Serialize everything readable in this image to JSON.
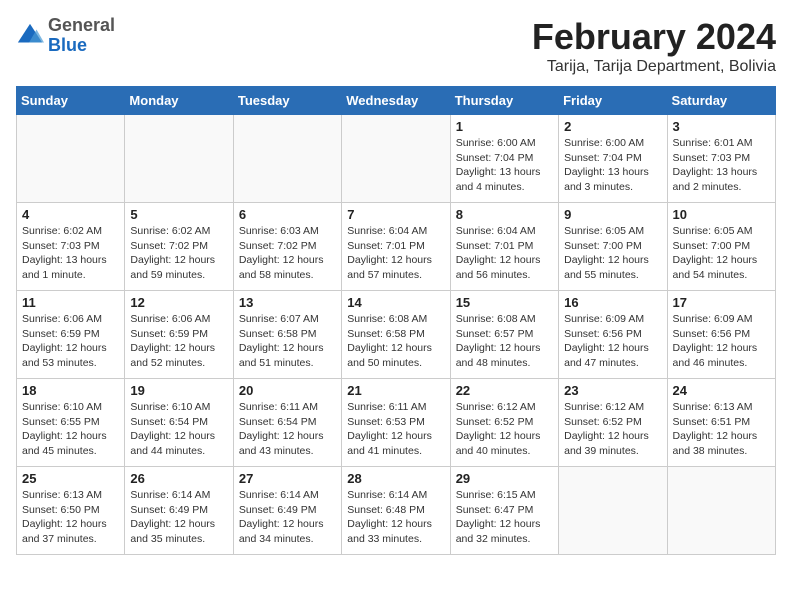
{
  "header": {
    "logo_line1": "General",
    "logo_line2": "Blue",
    "title": "February 2024",
    "subtitle": "Tarija, Tarija Department, Bolivia"
  },
  "calendar": {
    "weekdays": [
      "Sunday",
      "Monday",
      "Tuesday",
      "Wednesday",
      "Thursday",
      "Friday",
      "Saturday"
    ],
    "weeks": [
      [
        {
          "day": "",
          "info": ""
        },
        {
          "day": "",
          "info": ""
        },
        {
          "day": "",
          "info": ""
        },
        {
          "day": "",
          "info": ""
        },
        {
          "day": "1",
          "info": "Sunrise: 6:00 AM\nSunset: 7:04 PM\nDaylight: 13 hours\nand 4 minutes."
        },
        {
          "day": "2",
          "info": "Sunrise: 6:00 AM\nSunset: 7:04 PM\nDaylight: 13 hours\nand 3 minutes."
        },
        {
          "day": "3",
          "info": "Sunrise: 6:01 AM\nSunset: 7:03 PM\nDaylight: 13 hours\nand 2 minutes."
        }
      ],
      [
        {
          "day": "4",
          "info": "Sunrise: 6:02 AM\nSunset: 7:03 PM\nDaylight: 13 hours\nand 1 minute."
        },
        {
          "day": "5",
          "info": "Sunrise: 6:02 AM\nSunset: 7:02 PM\nDaylight: 12 hours\nand 59 minutes."
        },
        {
          "day": "6",
          "info": "Sunrise: 6:03 AM\nSunset: 7:02 PM\nDaylight: 12 hours\nand 58 minutes."
        },
        {
          "day": "7",
          "info": "Sunrise: 6:04 AM\nSunset: 7:01 PM\nDaylight: 12 hours\nand 57 minutes."
        },
        {
          "day": "8",
          "info": "Sunrise: 6:04 AM\nSunset: 7:01 PM\nDaylight: 12 hours\nand 56 minutes."
        },
        {
          "day": "9",
          "info": "Sunrise: 6:05 AM\nSunset: 7:00 PM\nDaylight: 12 hours\nand 55 minutes."
        },
        {
          "day": "10",
          "info": "Sunrise: 6:05 AM\nSunset: 7:00 PM\nDaylight: 12 hours\nand 54 minutes."
        }
      ],
      [
        {
          "day": "11",
          "info": "Sunrise: 6:06 AM\nSunset: 6:59 PM\nDaylight: 12 hours\nand 53 minutes."
        },
        {
          "day": "12",
          "info": "Sunrise: 6:06 AM\nSunset: 6:59 PM\nDaylight: 12 hours\nand 52 minutes."
        },
        {
          "day": "13",
          "info": "Sunrise: 6:07 AM\nSunset: 6:58 PM\nDaylight: 12 hours\nand 51 minutes."
        },
        {
          "day": "14",
          "info": "Sunrise: 6:08 AM\nSunset: 6:58 PM\nDaylight: 12 hours\nand 50 minutes."
        },
        {
          "day": "15",
          "info": "Sunrise: 6:08 AM\nSunset: 6:57 PM\nDaylight: 12 hours\nand 48 minutes."
        },
        {
          "day": "16",
          "info": "Sunrise: 6:09 AM\nSunset: 6:56 PM\nDaylight: 12 hours\nand 47 minutes."
        },
        {
          "day": "17",
          "info": "Sunrise: 6:09 AM\nSunset: 6:56 PM\nDaylight: 12 hours\nand 46 minutes."
        }
      ],
      [
        {
          "day": "18",
          "info": "Sunrise: 6:10 AM\nSunset: 6:55 PM\nDaylight: 12 hours\nand 45 minutes."
        },
        {
          "day": "19",
          "info": "Sunrise: 6:10 AM\nSunset: 6:54 PM\nDaylight: 12 hours\nand 44 minutes."
        },
        {
          "day": "20",
          "info": "Sunrise: 6:11 AM\nSunset: 6:54 PM\nDaylight: 12 hours\nand 43 minutes."
        },
        {
          "day": "21",
          "info": "Sunrise: 6:11 AM\nSunset: 6:53 PM\nDaylight: 12 hours\nand 41 minutes."
        },
        {
          "day": "22",
          "info": "Sunrise: 6:12 AM\nSunset: 6:52 PM\nDaylight: 12 hours\nand 40 minutes."
        },
        {
          "day": "23",
          "info": "Sunrise: 6:12 AM\nSunset: 6:52 PM\nDaylight: 12 hours\nand 39 minutes."
        },
        {
          "day": "24",
          "info": "Sunrise: 6:13 AM\nSunset: 6:51 PM\nDaylight: 12 hours\nand 38 minutes."
        }
      ],
      [
        {
          "day": "25",
          "info": "Sunrise: 6:13 AM\nSunset: 6:50 PM\nDaylight: 12 hours\nand 37 minutes."
        },
        {
          "day": "26",
          "info": "Sunrise: 6:14 AM\nSunset: 6:49 PM\nDaylight: 12 hours\nand 35 minutes."
        },
        {
          "day": "27",
          "info": "Sunrise: 6:14 AM\nSunset: 6:49 PM\nDaylight: 12 hours\nand 34 minutes."
        },
        {
          "day": "28",
          "info": "Sunrise: 6:14 AM\nSunset: 6:48 PM\nDaylight: 12 hours\nand 33 minutes."
        },
        {
          "day": "29",
          "info": "Sunrise: 6:15 AM\nSunset: 6:47 PM\nDaylight: 12 hours\nand 32 minutes."
        },
        {
          "day": "",
          "info": ""
        },
        {
          "day": "",
          "info": ""
        }
      ]
    ]
  }
}
